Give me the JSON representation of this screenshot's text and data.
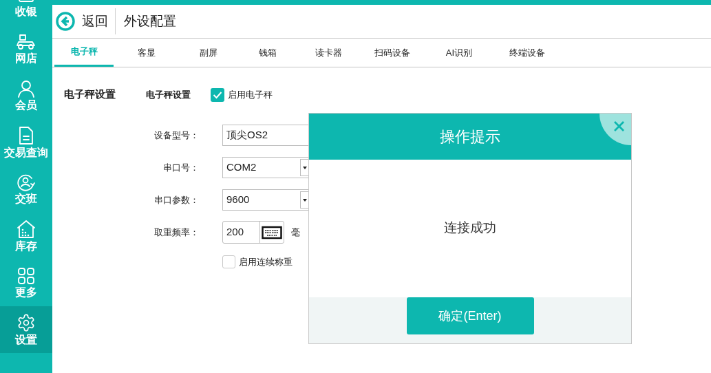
{
  "sidebar": {
    "items": [
      {
        "label": "收银",
        "kind": "cashier",
        "selected": false
      },
      {
        "label": "网店",
        "kind": "scooter",
        "selected": false
      },
      {
        "label": "会员",
        "kind": "member",
        "selected": false
      },
      {
        "label": "交易查询",
        "kind": "document",
        "selected": false
      },
      {
        "label": "交班",
        "kind": "shift",
        "selected": false
      },
      {
        "label": "库存",
        "kind": "house",
        "selected": false
      },
      {
        "label": "更多",
        "kind": "grid",
        "selected": false
      },
      {
        "label": "设置",
        "kind": "gear",
        "selected": true
      }
    ]
  },
  "header": {
    "back": "返回",
    "title": "外设配置"
  },
  "tabs": [
    {
      "label": "电子秤",
      "selected": true
    },
    {
      "label": "客显",
      "selected": false
    },
    {
      "label": "副屏",
      "selected": false
    },
    {
      "label": "钱箱",
      "selected": false
    },
    {
      "label": "读卡器",
      "selected": false
    },
    {
      "label": "扫码设备",
      "selected": false
    },
    {
      "label": "AI识别",
      "selected": false
    },
    {
      "label": "终端设备",
      "selected": false
    }
  ],
  "section": {
    "title": "电子秤设置",
    "subtitle": "电子秤设置",
    "enable": {
      "label": "启用电子秤",
      "checked": true
    }
  },
  "fields": [
    {
      "label": "设备型号：",
      "value": "顶尖OS2",
      "kind": "text"
    },
    {
      "label": "串口号：",
      "value": "COM2",
      "kind": "select"
    },
    {
      "label": "串口参数：",
      "value": "9600",
      "kind": "select"
    },
    {
      "label": "取重频率：",
      "value": "200",
      "kind": "keyboard",
      "unit": "毫"
    }
  ],
  "continuous": {
    "label": "启用连续称重",
    "checked": false
  },
  "dialog": {
    "title": "操作提示",
    "message": "连接成功",
    "button": "确定(Enter)"
  }
}
